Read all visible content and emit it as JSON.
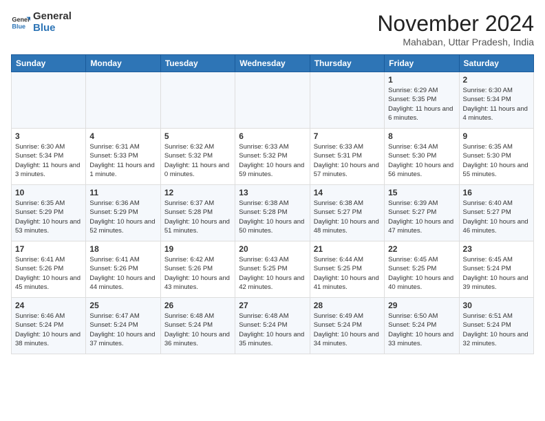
{
  "logo": {
    "line1": "General",
    "line2": "Blue"
  },
  "title": "November 2024",
  "subtitle": "Mahaban, Uttar Pradesh, India",
  "days_of_week": [
    "Sunday",
    "Monday",
    "Tuesday",
    "Wednesday",
    "Thursday",
    "Friday",
    "Saturday"
  ],
  "weeks": [
    [
      {
        "day": "",
        "info": ""
      },
      {
        "day": "",
        "info": ""
      },
      {
        "day": "",
        "info": ""
      },
      {
        "day": "",
        "info": ""
      },
      {
        "day": "",
        "info": ""
      },
      {
        "day": "1",
        "info": "Sunrise: 6:29 AM\nSunset: 5:35 PM\nDaylight: 11 hours and 6 minutes."
      },
      {
        "day": "2",
        "info": "Sunrise: 6:30 AM\nSunset: 5:34 PM\nDaylight: 11 hours and 4 minutes."
      }
    ],
    [
      {
        "day": "3",
        "info": "Sunrise: 6:30 AM\nSunset: 5:34 PM\nDaylight: 11 hours and 3 minutes."
      },
      {
        "day": "4",
        "info": "Sunrise: 6:31 AM\nSunset: 5:33 PM\nDaylight: 11 hours and 1 minute."
      },
      {
        "day": "5",
        "info": "Sunrise: 6:32 AM\nSunset: 5:32 PM\nDaylight: 11 hours and 0 minutes."
      },
      {
        "day": "6",
        "info": "Sunrise: 6:33 AM\nSunset: 5:32 PM\nDaylight: 10 hours and 59 minutes."
      },
      {
        "day": "7",
        "info": "Sunrise: 6:33 AM\nSunset: 5:31 PM\nDaylight: 10 hours and 57 minutes."
      },
      {
        "day": "8",
        "info": "Sunrise: 6:34 AM\nSunset: 5:30 PM\nDaylight: 10 hours and 56 minutes."
      },
      {
        "day": "9",
        "info": "Sunrise: 6:35 AM\nSunset: 5:30 PM\nDaylight: 10 hours and 55 minutes."
      }
    ],
    [
      {
        "day": "10",
        "info": "Sunrise: 6:35 AM\nSunset: 5:29 PM\nDaylight: 10 hours and 53 minutes."
      },
      {
        "day": "11",
        "info": "Sunrise: 6:36 AM\nSunset: 5:29 PM\nDaylight: 10 hours and 52 minutes."
      },
      {
        "day": "12",
        "info": "Sunrise: 6:37 AM\nSunset: 5:28 PM\nDaylight: 10 hours and 51 minutes."
      },
      {
        "day": "13",
        "info": "Sunrise: 6:38 AM\nSunset: 5:28 PM\nDaylight: 10 hours and 50 minutes."
      },
      {
        "day": "14",
        "info": "Sunrise: 6:38 AM\nSunset: 5:27 PM\nDaylight: 10 hours and 48 minutes."
      },
      {
        "day": "15",
        "info": "Sunrise: 6:39 AM\nSunset: 5:27 PM\nDaylight: 10 hours and 47 minutes."
      },
      {
        "day": "16",
        "info": "Sunrise: 6:40 AM\nSunset: 5:27 PM\nDaylight: 10 hours and 46 minutes."
      }
    ],
    [
      {
        "day": "17",
        "info": "Sunrise: 6:41 AM\nSunset: 5:26 PM\nDaylight: 10 hours and 45 minutes."
      },
      {
        "day": "18",
        "info": "Sunrise: 6:41 AM\nSunset: 5:26 PM\nDaylight: 10 hours and 44 minutes."
      },
      {
        "day": "19",
        "info": "Sunrise: 6:42 AM\nSunset: 5:26 PM\nDaylight: 10 hours and 43 minutes."
      },
      {
        "day": "20",
        "info": "Sunrise: 6:43 AM\nSunset: 5:25 PM\nDaylight: 10 hours and 42 minutes."
      },
      {
        "day": "21",
        "info": "Sunrise: 6:44 AM\nSunset: 5:25 PM\nDaylight: 10 hours and 41 minutes."
      },
      {
        "day": "22",
        "info": "Sunrise: 6:45 AM\nSunset: 5:25 PM\nDaylight: 10 hours and 40 minutes."
      },
      {
        "day": "23",
        "info": "Sunrise: 6:45 AM\nSunset: 5:24 PM\nDaylight: 10 hours and 39 minutes."
      }
    ],
    [
      {
        "day": "24",
        "info": "Sunrise: 6:46 AM\nSunset: 5:24 PM\nDaylight: 10 hours and 38 minutes."
      },
      {
        "day": "25",
        "info": "Sunrise: 6:47 AM\nSunset: 5:24 PM\nDaylight: 10 hours and 37 minutes."
      },
      {
        "day": "26",
        "info": "Sunrise: 6:48 AM\nSunset: 5:24 PM\nDaylight: 10 hours and 36 minutes."
      },
      {
        "day": "27",
        "info": "Sunrise: 6:48 AM\nSunset: 5:24 PM\nDaylight: 10 hours and 35 minutes."
      },
      {
        "day": "28",
        "info": "Sunrise: 6:49 AM\nSunset: 5:24 PM\nDaylight: 10 hours and 34 minutes."
      },
      {
        "day": "29",
        "info": "Sunrise: 6:50 AM\nSunset: 5:24 PM\nDaylight: 10 hours and 33 minutes."
      },
      {
        "day": "30",
        "info": "Sunrise: 6:51 AM\nSunset: 5:24 PM\nDaylight: 10 hours and 32 minutes."
      }
    ]
  ]
}
